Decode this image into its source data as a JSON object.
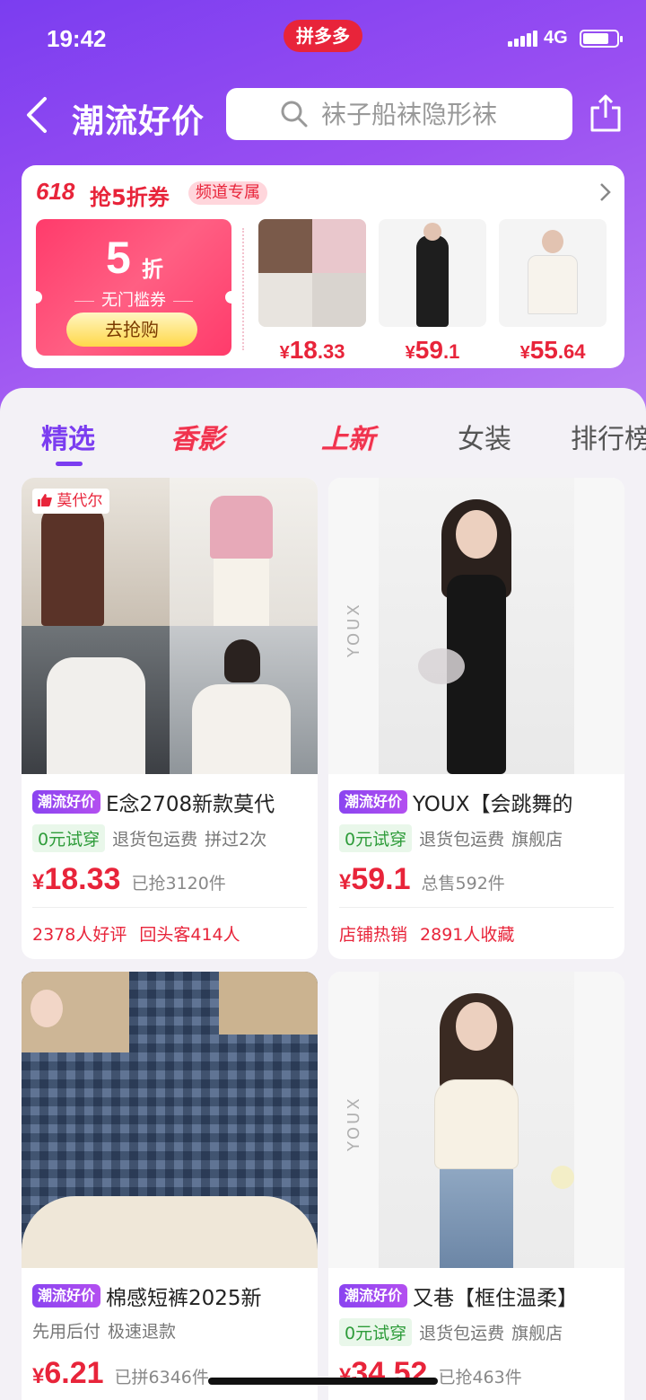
{
  "status": {
    "time": "19:42",
    "app_badge": "拼多多",
    "network": "4G"
  },
  "header": {
    "title": "潮流好价",
    "search_placeholder": "袜子船袜隐形袜"
  },
  "promo": {
    "badge_618": "618",
    "title": "抢5折券",
    "tag": "频道专属",
    "coupon": {
      "value": "5",
      "unit": "折",
      "desc": "无门槛券",
      "button": "去抢购"
    },
    "items": [
      {
        "cur": "¥",
        "int": "18",
        "dec": ".33"
      },
      {
        "cur": "¥",
        "int": "59",
        "dec": ".1"
      },
      {
        "cur": "¥",
        "int": "55",
        "dec": ".64"
      }
    ]
  },
  "tabs": [
    "精选",
    "香影",
    "上新",
    "女装",
    "排行榜"
  ],
  "products": [
    {
      "badge": "潮流好价",
      "thumb_badge": "莫代尔",
      "title": "E念2708新款莫代",
      "tags": [
        "0元试穿",
        "退货包运费",
        "拼过2次"
      ],
      "price_cur": "¥",
      "price": "18.33",
      "sold": "已抢3120件",
      "foot": [
        "2378人好评",
        "回头客414人"
      ]
    },
    {
      "badge": "潮流好价",
      "brand_mark": "YOUX",
      "title": "YOUX【会跳舞的",
      "tags": [
        "0元试穿",
        "退货包运费",
        "旗舰店"
      ],
      "price_cur": "¥",
      "price": "59.1",
      "sold": "总售592件",
      "foot": [
        "店铺热销",
        "2891人收藏"
      ]
    },
    {
      "badge": "潮流好价",
      "title": "棉感短裤2025新",
      "tags": [
        "先用后付",
        "极速退款"
      ],
      "price_cur": "¥",
      "price": "6.21",
      "sold": "已拼6346件"
    },
    {
      "badge": "潮流好价",
      "brand_mark": "YOUX",
      "title": "又巷【框住温柔】",
      "tags": [
        "0元试穿",
        "退货包运费",
        "旗舰店"
      ],
      "price_cur": "¥",
      "price": "34.52",
      "sold": "已抢463件"
    }
  ],
  "colors": {
    "accent": "#7b3df0",
    "price": "#e8243a",
    "green": "#2e9c3a"
  },
  "icons": [
    "back-icon",
    "search-icon",
    "share-icon",
    "chevron-right-icon",
    "thumbs-up-icon"
  ]
}
